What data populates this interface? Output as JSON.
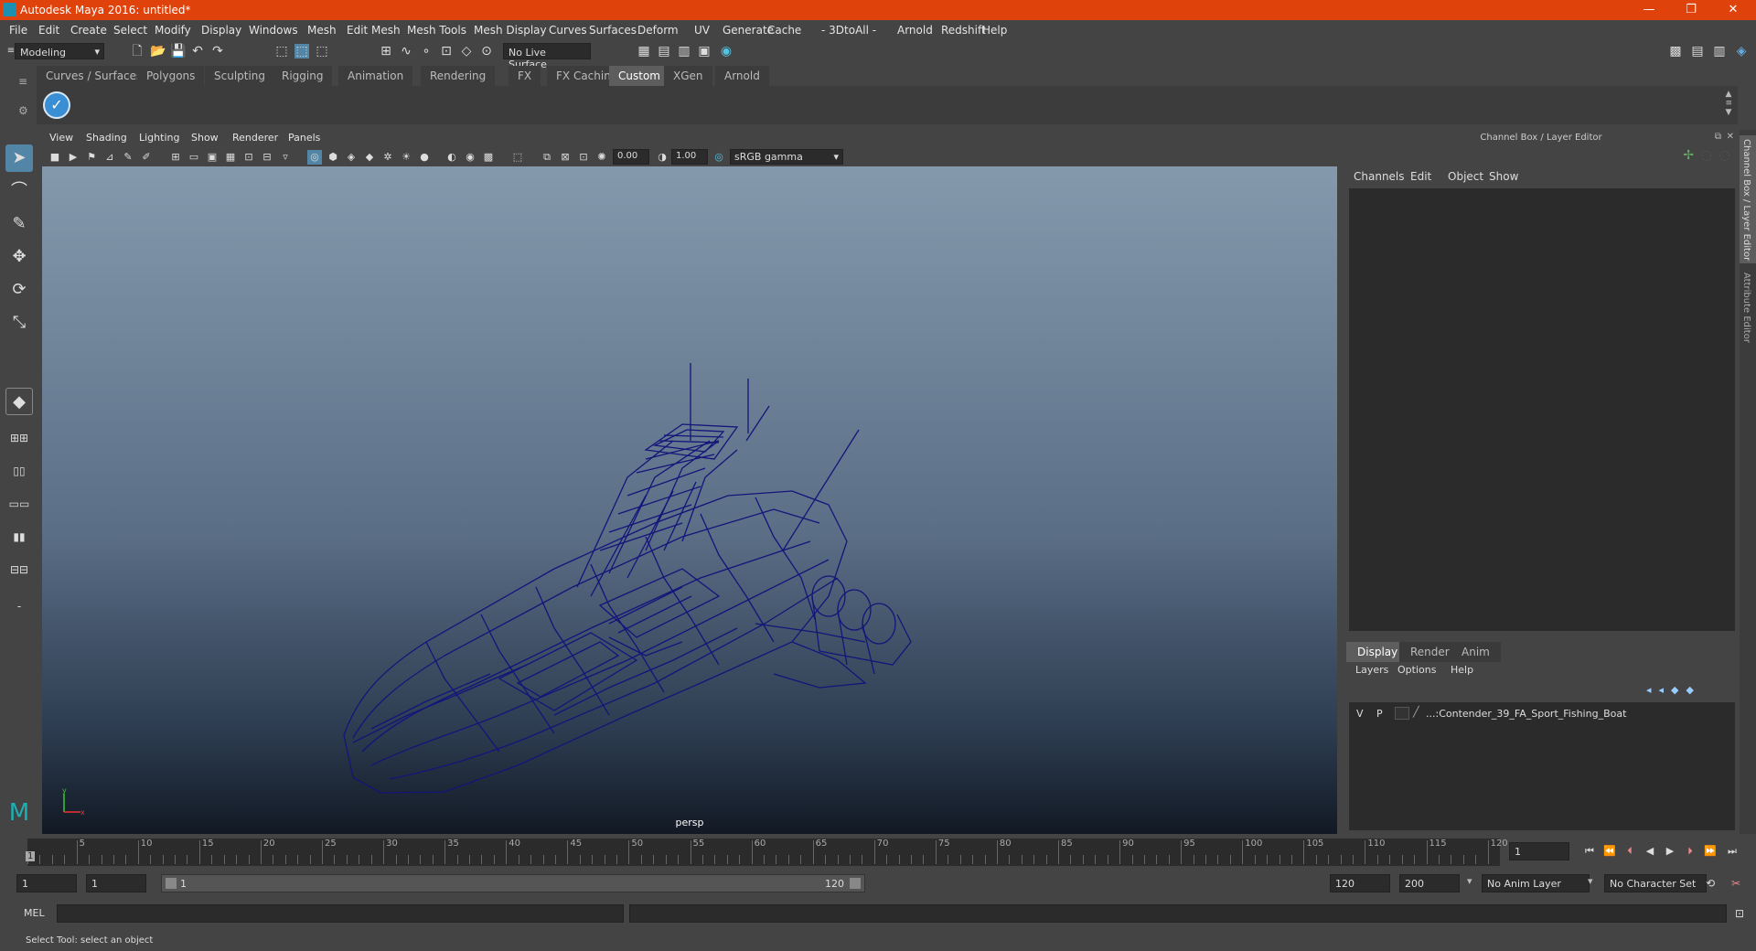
{
  "window": {
    "title": "Autodesk Maya 2016: untitled*",
    "controls": [
      "—",
      "❐",
      "✕"
    ]
  },
  "menubar": [
    "File",
    "Edit",
    "Create",
    "Select",
    "Modify",
    "Display",
    "Windows",
    "Mesh",
    "Edit Mesh",
    "Mesh Tools",
    "Mesh Display",
    "Curves",
    "Surfaces",
    "Deform",
    "UV",
    "Generate",
    "Cache",
    "- 3DtoAll -",
    "Arnold",
    "Redshift",
    "Help"
  ],
  "statusline": {
    "mode": "Modeling",
    "live_surface": "No Live Surface"
  },
  "shelf_tabs": [
    "Curves / Surfaces",
    "Polygons",
    "Sculpting",
    "Rigging",
    "Animation",
    "Rendering",
    "FX",
    "FX Caching",
    "Custom",
    "XGen",
    "Arnold"
  ],
  "shelf_active_tab": "Custom",
  "viewport": {
    "menus": [
      "View",
      "Shading",
      "Lighting",
      "Show",
      "Renderer",
      "Panels"
    ],
    "exposure": "0.00",
    "gamma": "1.00",
    "color_space": "sRGB gamma",
    "camera_label": "persp",
    "wire_color": "#14147a"
  },
  "channel_box": {
    "header": "Channel Box / Layer Editor",
    "menus": [
      "Channels",
      "Edit",
      "Object",
      "Show"
    ],
    "layer_tabs": [
      "Display",
      "Render",
      "Anim"
    ],
    "active_layer_tab": "Display",
    "layer_menus": [
      "Layers",
      "Options",
      "Help"
    ],
    "layer": {
      "v": "V",
      "p": "P",
      "name": "...:Contender_39_FA_Sport_Fishing_Boat"
    }
  },
  "side_tabs": [
    "Channel Box / Layer Editor",
    "Attribute Editor"
  ],
  "timeline": {
    "ticks": [
      "5",
      "10",
      "15",
      "20",
      "25",
      "30",
      "35",
      "40",
      "45",
      "50",
      "55",
      "60",
      "65",
      "70",
      "75",
      "80",
      "85",
      "90",
      "95",
      "100",
      "105",
      "110",
      "115",
      "120"
    ],
    "current_marker": "1",
    "current_frame": "1"
  },
  "range": {
    "start": "1",
    "anim_start": "1",
    "slider_start": "1",
    "slider_end": "120",
    "end": "120",
    "anim_end": "200",
    "anim_layer": "No Anim Layer",
    "char_set": "No Character Set"
  },
  "mel": {
    "label": "MEL"
  },
  "help_line": "Select Tool: select an object"
}
